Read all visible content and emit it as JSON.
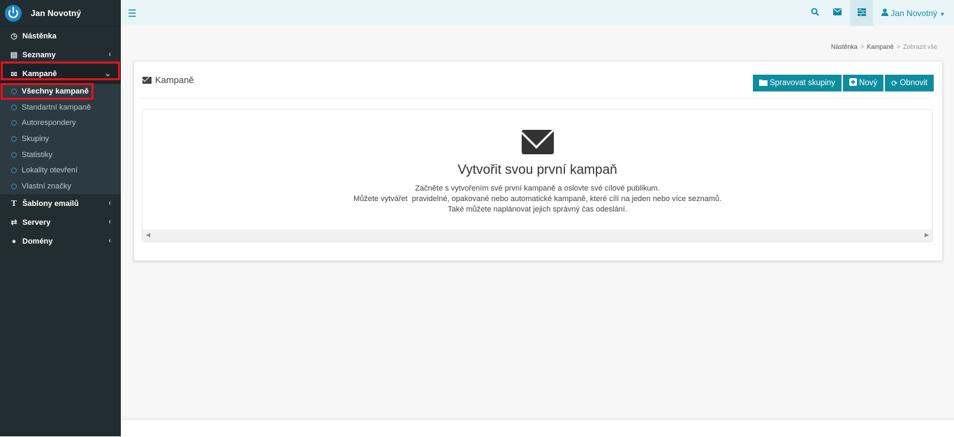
{
  "brand": {
    "name": "Jan Novotný"
  },
  "sidebar": {
    "items": [
      {
        "label": "Nástěnka",
        "icon": "dashboard-icon"
      },
      {
        "label": "Seznamy",
        "icon": "list-icon"
      },
      {
        "label": "Kampaně",
        "icon": "envelope-icon"
      },
      {
        "label": "Šablony emailů",
        "icon": "text-icon"
      },
      {
        "label": "Servery",
        "icon": "exchange-icon"
      },
      {
        "label": "Domény",
        "icon": "globe-icon"
      }
    ],
    "submenu": [
      {
        "label": "Všechny kampaně"
      },
      {
        "label": "Standartní kampaně"
      },
      {
        "label": "Autorespondery"
      },
      {
        "label": "Skupiny"
      },
      {
        "label": "Statistiky"
      },
      {
        "label": "Lokality otevření"
      },
      {
        "label": "Vlastní značky"
      }
    ]
  },
  "topbar": {
    "user": "Jan Novotný"
  },
  "breadcrumb": {
    "items": [
      "Nástěnka",
      "Kampaně",
      "Zobrazit vše"
    ]
  },
  "panel": {
    "title": "Kampaně",
    "buttons": {
      "groups": "Spravovat skupiny",
      "new": "Nový",
      "refresh": "Obnovit"
    }
  },
  "empty": {
    "title": "Vytvořit svou první kampaň",
    "line1": "Začněte s vytvořením své první kampaně a oslovte své cílové publikum.",
    "line2": "Můžete vytvářet  pravidelné, opakované nebo automatické kampaně, které cílí na jeden nebo více seznamů.",
    "line3": "Také můžete naplánovat jejich správný čas odeslání."
  },
  "colors": {
    "accent": "#0e8ca0",
    "sidebar": "#222d32",
    "highlight": "#e0141b"
  }
}
